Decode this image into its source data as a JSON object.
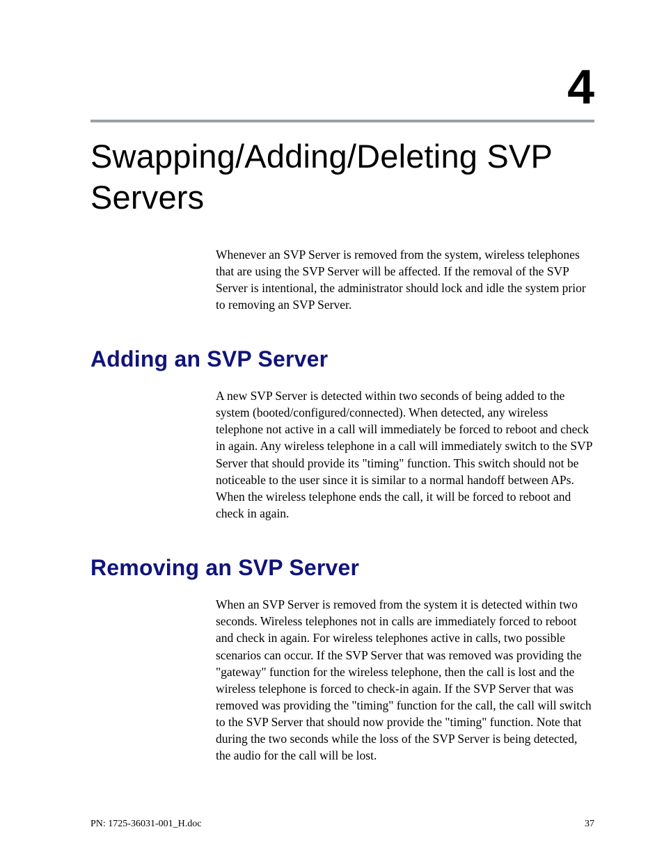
{
  "chapter": {
    "number": "4",
    "title": "Swapping/Adding/Deleting SVP Servers",
    "intro": "Whenever an SVP Server is removed from the system, wireless telephones that are using the SVP Server will be affected. If the removal of the SVP Server is intentional, the administrator should lock and idle the system prior to removing an SVP Server."
  },
  "sections": [
    {
      "heading": "Adding an SVP Server",
      "body": "A new SVP Server is detected within two seconds of being added to the system (booted/configured/connected). When detected, any wireless telephone not active in a call will immediately be forced to reboot and check in again. Any wireless telephone in a call will immediately switch to the SVP Server that should provide its \"timing\" function. This switch should not be noticeable to the user since it is similar to a normal handoff between APs. When the wireless telephone ends the call, it will be forced to reboot and check in again."
    },
    {
      "heading": "Removing an SVP Server",
      "body": "When an SVP Server is removed from the system it is detected within two seconds. Wireless telephones not in calls are immediately forced to reboot and check in again. For wireless telephones active in calls, two possible scenarios can occur. If the SVP Server that was removed was providing the \"gateway\" function for the wireless telephone, then the call is lost and the wireless telephone is forced to check-in again. If the SVP Server that was removed was providing the \"timing\" function for the call, the call will switch to the SVP Server that should now provide the \"timing\" function. Note that during the two seconds while the loss of the SVP Server is being detected, the audio for the call will be lost."
    }
  ],
  "footer": {
    "left": "PN: 1725-36031-001_H.doc",
    "right": "37"
  },
  "colors": {
    "heading_blue": "#10147a",
    "rule_gray": "#9aa0a6"
  }
}
